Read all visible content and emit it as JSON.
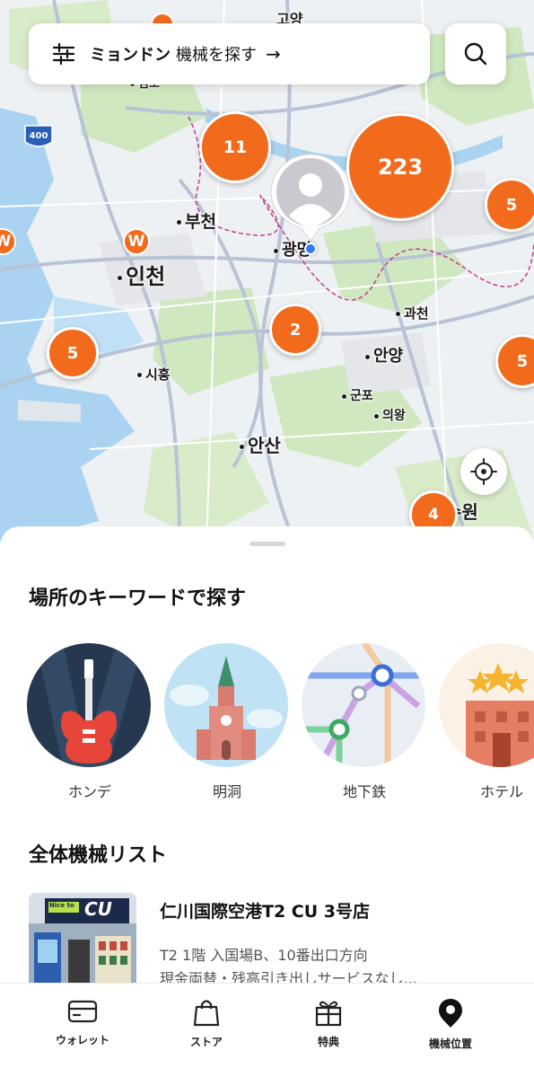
{
  "search": {
    "location": "ミョンドン",
    "query": "機械を探す",
    "arrow": "→"
  },
  "map": {
    "clusters": [
      "11",
      "223",
      "5",
      "2",
      "5",
      "5",
      "4"
    ],
    "places": {
      "incheon": "인천",
      "bucheon": "부천",
      "gwangmyeong": "광명",
      "gwacheon": "과천",
      "anyang": "안양",
      "siheung": "시흥",
      "gunpo": "군포",
      "uiwang": "의왕",
      "ansan": "안산",
      "suwon": "수원",
      "goyang": "고양",
      "gimpo": "김포"
    },
    "highway_shield": "400",
    "brand_pin_letter": "W"
  },
  "keywords": {
    "title": "場所のキーワードで探す",
    "items": [
      {
        "label": "ホンデ"
      },
      {
        "label": "明洞"
      },
      {
        "label": "地下鉄"
      },
      {
        "label": "ホテル"
      }
    ]
  },
  "machines": {
    "title": "全体機械リスト",
    "items": [
      {
        "name": "仁川国際空港T2 CU 3号店",
        "address": "T2 1階 入国場B、10番出口方向",
        "note": "現金両替・残高引き出しサービスなし...",
        "thumb_sign_text": "Nice to",
        "thumb_brand": "CU"
      }
    ]
  },
  "tabbar": {
    "tabs": [
      {
        "label": "ウォレット"
      },
      {
        "label": "ストア"
      },
      {
        "label": "特典"
      },
      {
        "label": "機械位置"
      }
    ]
  },
  "colors": {
    "accent": "#f26a1b",
    "map_green": "#cfe8bf",
    "map_water": "#a9d3f0",
    "road": "#b9c3d6"
  }
}
